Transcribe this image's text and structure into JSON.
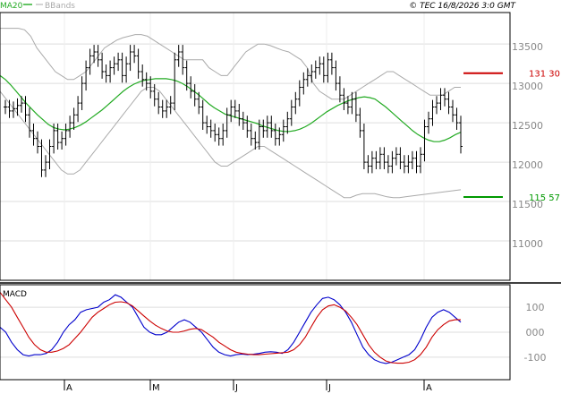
{
  "header": {
    "legend_ma": "MA20",
    "legend_bb": "BBands",
    "stamp": "© TEC 16/8/2026 3:0 GMT"
  },
  "colors": {
    "price": "#000000",
    "ma": "#22aa22",
    "bbands": "#aaaaaa",
    "resistance": "#cc0000",
    "support": "#009900",
    "macd": "#0000cc",
    "signal": "#cc0000",
    "grid": "#dddddd",
    "frame": "#000000"
  },
  "chart_data": [
    {
      "type": "candlestick-bars",
      "title": "",
      "xlabel": "",
      "ylabel": "",
      "ylim": [
        10500,
        13900
      ],
      "yticks": [
        "13500",
        "13000",
        "12500",
        "12000",
        "11500",
        "11000"
      ],
      "xticks": [
        "A",
        "M",
        "J",
        "J",
        "A"
      ],
      "grid": true,
      "levels": [
        {
          "name": "resistance",
          "label": "131 30",
          "value": 13130
        },
        {
          "name": "support",
          "label": "115 57",
          "value": 11557
        }
      ],
      "series": [
        {
          "name": "price",
          "values": [
            12700,
            12650,
            12680,
            12720,
            12750,
            12600,
            12400,
            12300,
            12200,
            11900,
            12000,
            12200,
            12400,
            12250,
            12300,
            12400,
            12500,
            12600,
            12750,
            13000,
            13200,
            13350,
            13400,
            13300,
            13150,
            13100,
            13200,
            13250,
            13300,
            13100,
            13250,
            13400,
            13350,
            13150,
            13050,
            13000,
            12900,
            12800,
            12700,
            12650,
            12700,
            12750,
            13300,
            13400,
            13200,
            13000,
            12900,
            12800,
            12700,
            12500,
            12450,
            12400,
            12350,
            12300,
            12400,
            12600,
            12700,
            12650,
            12550,
            12500,
            12400,
            12300,
            12250,
            12450,
            12400,
            12500,
            12400,
            12300,
            12350,
            12450,
            12550,
            12700,
            12800,
            12950,
            13050,
            13100,
            13150,
            13200,
            13250,
            13100,
            13300,
            13200,
            13000,
            12850,
            12750,
            12700,
            12800,
            12600,
            12400,
            12000,
            11950,
            12050,
            12000,
            12100,
            12000,
            11950,
            12050,
            12100,
            12000,
            11950,
            12000,
            12050,
            11950,
            12100,
            12450,
            12550,
            12700,
            12750,
            12850,
            12800,
            12700,
            12600,
            12500,
            12200
          ]
        },
        {
          "name": "MA20",
          "values": [
            13100,
            13050,
            12980,
            12900,
            12820,
            12740,
            12670,
            12600,
            12540,
            12480,
            12440,
            12420,
            12410,
            12420,
            12440,
            12470,
            12510,
            12560,
            12610,
            12660,
            12720,
            12780,
            12840,
            12900,
            12950,
            12990,
            13020,
            13040,
            13050,
            13060,
            13060,
            13060,
            13050,
            13030,
            13000,
            12960,
            12910,
            12860,
            12800,
            12740,
            12690,
            12650,
            12610,
            12590,
            12570,
            12550,
            12530,
            12510,
            12490,
            12460,
            12440,
            12420,
            12400,
            12390,
            12390,
            12400,
            12420,
            12450,
            12490,
            12540,
            12590,
            12640,
            12680,
            12720,
            12750,
            12780,
            12800,
            12820,
            12830,
            12820,
            12800,
            12750,
            12700,
            12640,
            12580,
            12520,
            12460,
            12400,
            12350,
            12310,
            12280,
            12260,
            12260,
            12280,
            12310,
            12350,
            12380
          ]
        },
        {
          "name": "BB upper",
          "values": [
            13700,
            13700,
            13700,
            13700,
            13680,
            13600,
            13450,
            13350,
            13250,
            13150,
            13100,
            13050,
            13050,
            13100,
            13150,
            13250,
            13350,
            13450,
            13500,
            13550,
            13580,
            13600,
            13620,
            13620,
            13600,
            13550,
            13500,
            13450,
            13400,
            13350,
            13300,
            13300,
            13300,
            13300,
            13200,
            13150,
            13100,
            13100,
            13200,
            13300,
            13400,
            13450,
            13500,
            13500,
            13480,
            13450,
            13420,
            13400,
            13350,
            13300,
            13200,
            13000,
            12900,
            12850,
            12800,
            12800,
            12800,
            12850,
            12900,
            12950,
            13000,
            13050,
            13100,
            13150,
            13150,
            13100,
            13050,
            13000,
            12950,
            12900,
            12850,
            12850,
            12850,
            12900,
            12950,
            12950
          ]
        },
        {
          "name": "BB lower",
          "values": [
            12900,
            12800,
            12700,
            12600,
            12500,
            12400,
            12300,
            12200,
            12100,
            12000,
            11900,
            11850,
            11850,
            11900,
            12000,
            12100,
            12200,
            12300,
            12400,
            12500,
            12600,
            12700,
            12800,
            12900,
            12950,
            12950,
            12900,
            12800,
            12700,
            12600,
            12500,
            12400,
            12300,
            12200,
            12100,
            12000,
            11950,
            11950,
            12000,
            12050,
            12100,
            12150,
            12200,
            12200,
            12150,
            12100,
            12050,
            12000,
            11950,
            11900,
            11850,
            11800,
            11750,
            11700,
            11650,
            11600,
            11550,
            11550,
            11580,
            11600,
            11600,
            11600,
            11580,
            11560,
            11550,
            11550,
            11560,
            11570,
            11580,
            11590,
            11600,
            11610,
            11620,
            11630,
            11640,
            11650
          ]
        }
      ]
    },
    {
      "type": "line",
      "title": "MACD",
      "xlabel": "",
      "ylabel": "",
      "ylim": [
        -190,
        190
      ],
      "yticks": [
        "100",
        "000",
        "-100"
      ],
      "grid": true,
      "series": [
        {
          "name": "MACD",
          "values": [
            20,
            0,
            -40,
            -70,
            -90,
            -95,
            -90,
            -90,
            -85,
            -70,
            -40,
            0,
            30,
            50,
            80,
            90,
            95,
            100,
            120,
            130,
            150,
            140,
            120,
            100,
            60,
            20,
            0,
            -10,
            -10,
            0,
            20,
            40,
            50,
            40,
            20,
            0,
            -30,
            -60,
            -80,
            -90,
            -95,
            -90,
            -88,
            -90,
            -88,
            -85,
            -80,
            -78,
            -80,
            -85,
            -70,
            -40,
            0,
            40,
            80,
            110,
            135,
            140,
            130,
            110,
            80,
            40,
            -10,
            -60,
            -90,
            -110,
            -120,
            -125,
            -120,
            -110,
            -100,
            -90,
            -70,
            -30,
            20,
            60,
            80,
            90,
            80,
            60,
            40
          ]
        },
        {
          "name": "Signal",
          "values": [
            160,
            130,
            100,
            60,
            20,
            -20,
            -50,
            -70,
            -80,
            -80,
            -75,
            -65,
            -50,
            -25,
            0,
            30,
            60,
            80,
            95,
            110,
            120,
            122,
            118,
            105,
            85,
            65,
            45,
            28,
            15,
            5,
            0,
            0,
            5,
            12,
            15,
            10,
            -5,
            -20,
            -40,
            -55,
            -70,
            -80,
            -85,
            -88,
            -90,
            -90,
            -88,
            -86,
            -84,
            -82,
            -80,
            -70,
            -50,
            -20,
            20,
            60,
            90,
            105,
            110,
            100,
            85,
            60,
            30,
            -10,
            -50,
            -80,
            -100,
            -115,
            -122,
            -124,
            -124,
            -120,
            -110,
            -90,
            -60,
            -20,
            10,
            30,
            45,
            50,
            50
          ]
        }
      ]
    }
  ]
}
